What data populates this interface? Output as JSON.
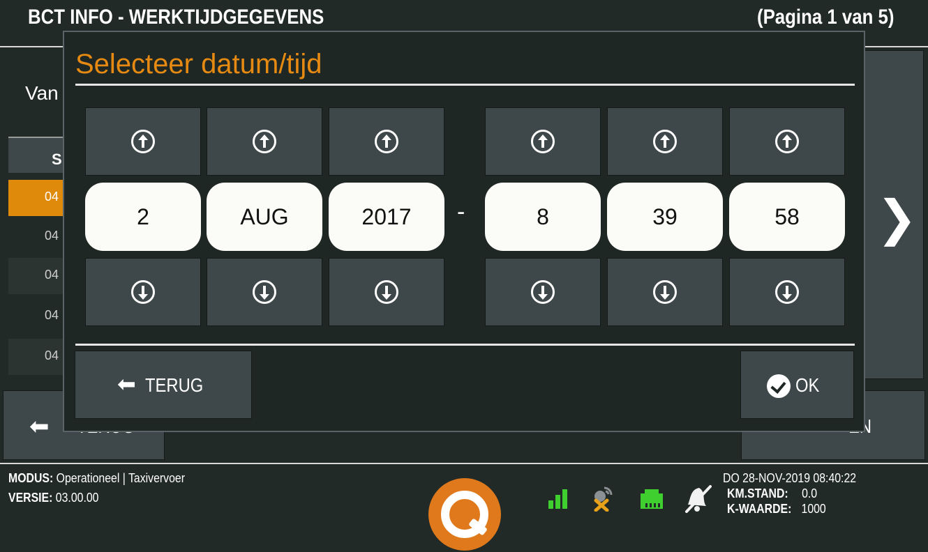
{
  "header": {
    "title": "BCT INFO - WERKTIJDGEGEVENS",
    "page_indicator": "(Pagina 1 van 5)"
  },
  "background": {
    "label_partial": "Van",
    "column_header_partial": "S",
    "rows_partial": [
      "04",
      "04",
      "04",
      "04",
      "04"
    ],
    "back_button_label": "TERUG",
    "print_button_label_partial": "EN",
    "selected_row_color": "#e08a0c"
  },
  "modal": {
    "title": "Selecteer datum/tijd",
    "fields": {
      "day": "2",
      "month": "AUG",
      "year": "2017",
      "separator": "-",
      "hour": "8",
      "minute": "39",
      "second": "58"
    },
    "back_button": "TERUG",
    "ok_button": "OK",
    "accent_color": "#e78a12"
  },
  "footer": {
    "mode_label": "MODUS:",
    "mode_value": "Operationeel | Taxivervoer",
    "version_label": "VERSIE:",
    "version_value": "03.00.00",
    "datetime": "DO 28-NOV-2019 08:40:22",
    "km_label": "KM.STAND:",
    "km_value": "0.0",
    "k_label": "K-WAARDE:",
    "k_value": "1000",
    "icons": [
      "signal-strength-icon",
      "gps-disconnected-icon",
      "network-port-icon",
      "bell-muted-icon"
    ]
  }
}
